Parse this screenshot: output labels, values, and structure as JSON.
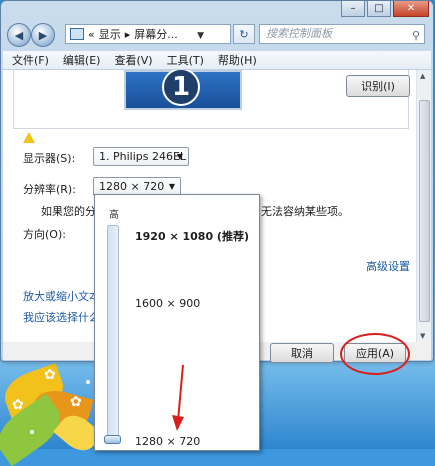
{
  "window": {
    "address": {
      "arrows": "«",
      "crumb1": "显示",
      "sep": "▸",
      "crumb2": "屏幕分..."
    },
    "search_placeholder": "搜索控制面板",
    "menu": [
      "文件(F)",
      "编辑(E)",
      "查看(V)",
      "工具(T)",
      "帮助(H)"
    ]
  },
  "preview": {
    "monitor_number": "1",
    "identify_button": "识别(I)"
  },
  "settings": {
    "display_label": "显示器(S):",
    "display_value": "1. Philips 246EL",
    "resolution_label": "分辨率(R):",
    "resolution_value": "1280 × 720",
    "warning_text_left": "如果您的分",
    "warning_text_right": "无法容纳某些项。",
    "orientation_label": "方向(O):",
    "advanced_link": "高级设置",
    "link_enlarge": "放大或缩小文本",
    "link_choose": "我应该选择什么"
  },
  "buttons": {
    "cancel": "取消",
    "apply": "应用(A)"
  },
  "resolution_popup": {
    "high_label": "高",
    "options": [
      {
        "label": "1920 × 1080 (推荐)",
        "bold": true
      },
      {
        "label": "1600 × 900",
        "bold": false
      },
      {
        "label": "1280 × 720",
        "bold": false
      }
    ],
    "slider_level_fraction": 0.0
  },
  "colors": {
    "annotation": "#d9201c",
    "link": "#1c5aa8",
    "desktop": "#3c97de"
  }
}
